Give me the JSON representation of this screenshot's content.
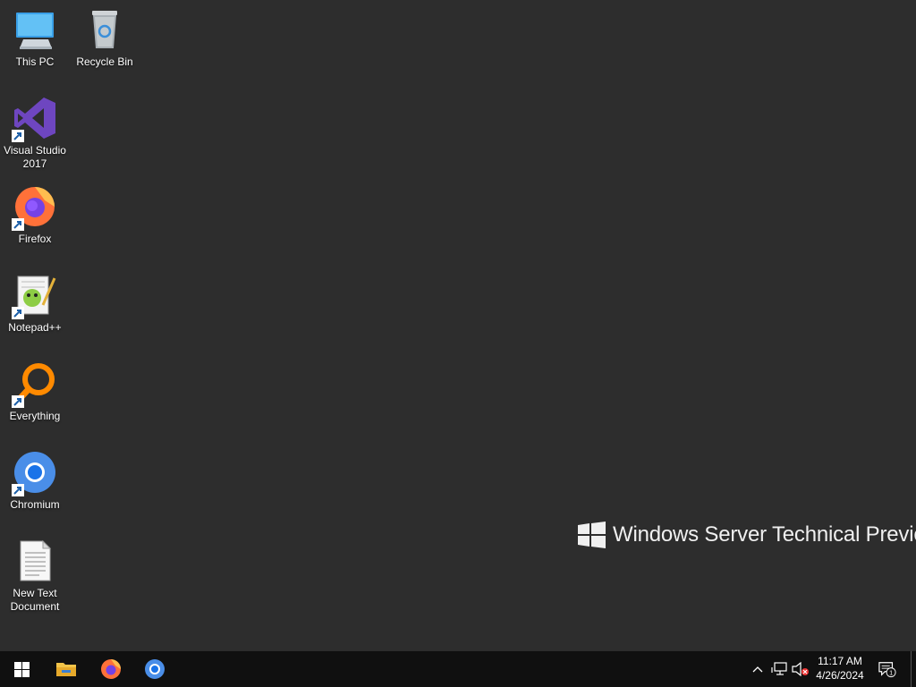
{
  "desktop": {
    "icons": [
      {
        "label": "This PC",
        "icon": "this-pc-icon",
        "shortcut": false
      },
      {
        "label": "Recycle Bin",
        "icon": "recycle-bin-icon",
        "shortcut": false
      },
      {
        "label": "Visual Studio\n2017",
        "icon": "visual-studio-icon",
        "shortcut": true
      },
      {
        "label": "Firefox",
        "icon": "firefox-icon",
        "shortcut": true
      },
      {
        "label": "Notepad++",
        "icon": "notepad-plus-plus-icon",
        "shortcut": true
      },
      {
        "label": "Everything",
        "icon": "everything-search-icon",
        "shortcut": true
      },
      {
        "label": "Chromium",
        "icon": "chromium-icon",
        "shortcut": true
      },
      {
        "label": "New Text\nDocument",
        "icon": "text-document-icon",
        "shortcut": false
      }
    ],
    "watermark": "Windows Server Technical Preview"
  },
  "taskbar": {
    "start_icon": "windows-logo-icon",
    "pinned": [
      {
        "name": "file-explorer",
        "icon": "folder-icon"
      },
      {
        "name": "firefox",
        "icon": "firefox-icon"
      },
      {
        "name": "chromium",
        "icon": "chromium-icon"
      }
    ],
    "tray": {
      "icons": [
        "chevron-up-icon",
        "network-icon",
        "volume-muted-icon"
      ],
      "time": "11:17 AM",
      "date": "4/26/2024",
      "notification_count": "1"
    }
  },
  "colors": {
    "desktop_bg": "#2d2d2d",
    "taskbar_bg": "#101010",
    "accent_blue": "#1e88e5"
  }
}
